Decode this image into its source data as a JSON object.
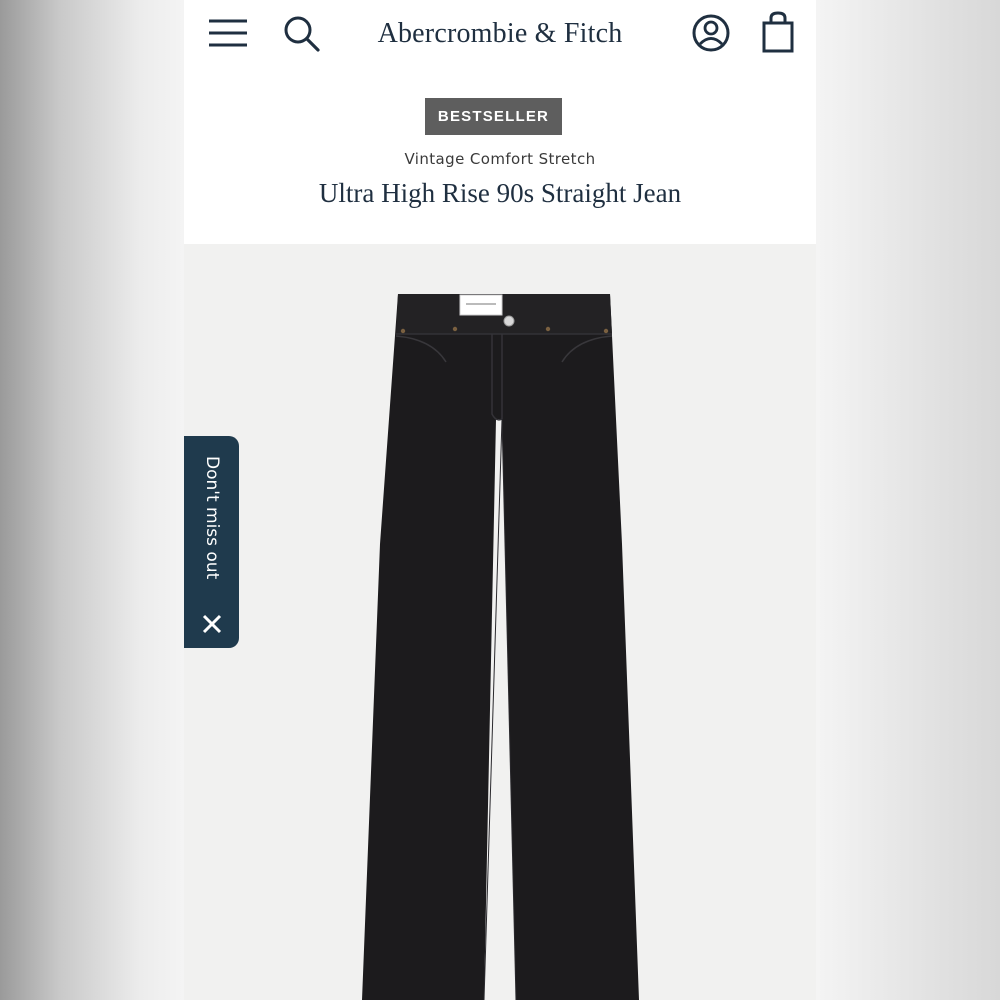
{
  "header": {
    "brand": "Abercrombie & Fitch",
    "menu_icon": "hamburger-menu-icon",
    "search_icon": "search-icon",
    "account_icon": "user-account-icon",
    "bag_icon": "shopping-bag-icon"
  },
  "product": {
    "badge": "BESTSELLER",
    "collection": "Vintage Comfort Stretch",
    "name": "Ultra High Rise 90s Straight Jean",
    "image": "black-straight-jeans-photo"
  },
  "promo": {
    "label": "Don't miss out",
    "close_icon": "close-icon"
  },
  "colors": {
    "brand_navy": "#1f2f40",
    "badge_gray": "#5e5e5e",
    "promo_tab": "#1f3a4d",
    "denim": "#1c1b1d"
  }
}
